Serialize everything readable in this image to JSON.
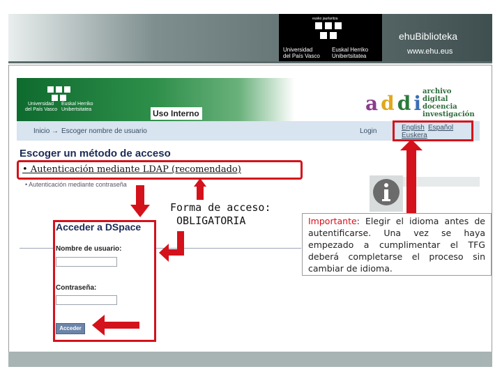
{
  "banner": {
    "logo_top": "eusko jaurlaritza",
    "logo_left_line1": "Universidad",
    "logo_left_line2": "del País Vasco",
    "logo_right_line1": "Euskal Herriko",
    "logo_right_line2": "Unibertsitatea",
    "site_name": "ehuBiblioteka",
    "site_url": "www.ehu.eus"
  },
  "screenshot": {
    "upv_line1": "Universidad",
    "upv_line2": "del País Vasco",
    "ehu_line1": "Euskal Herriko",
    "ehu_line2": "Unibertsitatea",
    "uso_interno": "Uso Interno",
    "addi_letters": [
      "a",
      "d",
      "d",
      "i"
    ],
    "addi_colors": [
      "#8a3c8c",
      "#e0a81c",
      "#2c7a3c",
      "#3b6fb5"
    ],
    "addi_sub": [
      "archivo",
      "digital",
      "docencia",
      "investigación"
    ],
    "breadcrumb_home": "Inicio",
    "breadcrumb_arrow": "→",
    "breadcrumb_current": "Escoger nombre de usuario",
    "login": "Login",
    "lang_english": "English",
    "lang_espanol": "Español",
    "lang_euskera": "Euskera",
    "page_title": "Escoger un método de acceso",
    "option_ldap": "• Autenticación mediante LDAP (recomendado)",
    "option_password": "• Autenticación mediante contraseña",
    "info_icon": "info-icon"
  },
  "login_form": {
    "title": "Acceder a DSpace",
    "username_label": "Nombre de usuario:",
    "username_value": "",
    "password_label": "Contraseña:",
    "password_value": "",
    "submit_label": "Acceder"
  },
  "callouts": {
    "forma_line1": "Forma de acceso:",
    "forma_line2": " OBLIGATORIA",
    "note_highlight": "Importante",
    "note_text": ": Elegir el idioma antes de autentificarse. Una vez se haya empezado a cumplimentar el TFG deberá completarse el proceso sin cambiar de idioma."
  },
  "colors": {
    "accent_red": "#d4121b",
    "header_green": "#0e6b2e",
    "title_navy": "#1b2b55"
  }
}
